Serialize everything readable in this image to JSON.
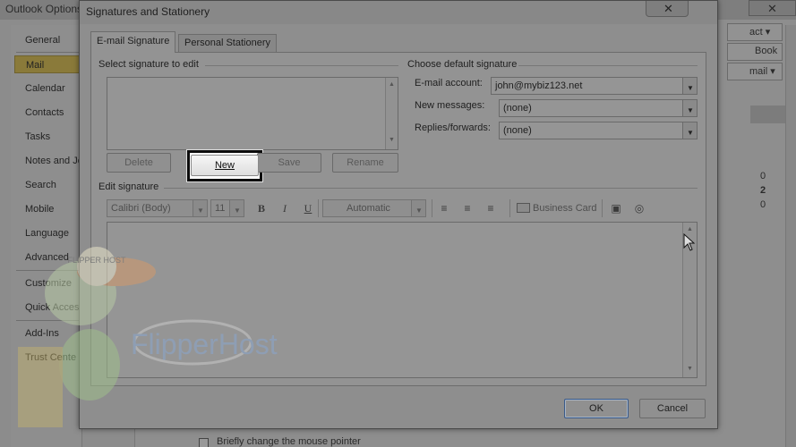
{
  "background": {
    "title": "Outlook Options",
    "close_glyph": "✕",
    "nav": [
      {
        "label": "General"
      },
      {
        "label": "Mail"
      },
      {
        "label": "Calendar"
      },
      {
        "label": "Contacts"
      },
      {
        "label": "Tasks"
      },
      {
        "label": "Notes and Jo"
      },
      {
        "label": "Search"
      },
      {
        "label": "Mobile"
      },
      {
        "label": "Language"
      },
      {
        "label": "Advanced"
      },
      {
        "label": "Customize"
      },
      {
        "label": "Quick Acces"
      },
      {
        "label": "Add-Ins"
      },
      {
        "label": "Trust Cente"
      }
    ],
    "selected_nav": "Mail",
    "right_panel": {
      "box1": "act ▾",
      "box2": "Book",
      "box3": "mail ▾",
      "numbers": [
        "0",
        "2",
        "0"
      ]
    },
    "bottom_text": "Briefly change the mouse pointer"
  },
  "watermark": {
    "text": "FlipperHost",
    "badge": "FLIPPER HOST"
  },
  "dialog": {
    "title": "Signatures and Stationery",
    "close_glyph": "✕",
    "tabs": {
      "email_signature": "E-mail Signature",
      "personal_stationery": "Personal Stationery"
    },
    "select_signature_label": "Select signature to edit",
    "buttons": {
      "delete": "Delete",
      "new": "New",
      "save": "Save",
      "rename": "Rename"
    },
    "default_signature": {
      "label": "Choose default signature",
      "email_account_label": "E-mail account:",
      "email_account_value": "john@mybiz123.net",
      "new_messages_label": "New messages:",
      "new_messages_value": "(none)",
      "replies_label": "Replies/forwards:",
      "replies_value": "(none)"
    },
    "edit_signature_label": "Edit signature",
    "toolbar": {
      "font": "Calibri (Body)",
      "size": "11",
      "bold": "B",
      "italic": "I",
      "underline": "U",
      "color": "Automatic",
      "business_card": "Business Card"
    },
    "ok": "OK",
    "cancel": "Cancel"
  }
}
